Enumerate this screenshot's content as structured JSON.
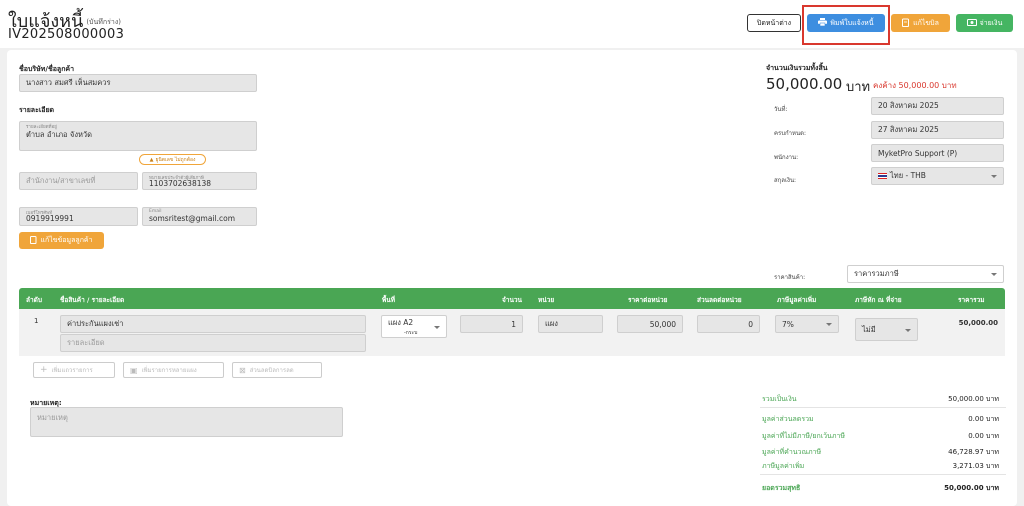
{
  "header": {
    "title": "ใบแจ้งหนี้",
    "title_note": "(บันทึกร่าง)",
    "doc_number": "IV202508000003"
  },
  "actions": {
    "close": "ปิดหน้าต่าง",
    "print": "พิมพ์ใบแจ้งหนี้",
    "edit": "แก้ไขบิล",
    "pay": "จ่ายเงิน"
  },
  "customer": {
    "section_label": "ชื่อบริษัท/ชื่อลูกค้า",
    "name": "นางสาว สมศรี เห็นสมควร",
    "detail_label": "รายละเอียด",
    "address_caption": "รายละเอียดที่อยู่",
    "address": "ตำบล อำเภอ จังหวัด",
    "branch_placeholder": "สำนักงาน/สาขาเลขที่",
    "verify_badge": "ยูนิตเลข ไม่ถูกต้อง",
    "tax_caption": "หมายเลขประจำตัวผู้เสียภาษี",
    "tax_id": "1103702638138",
    "phone_caption": "เบอร์โทรศัพท์",
    "phone": "0919919991",
    "email_caption": "Email",
    "email": "somsritest@gmail.com",
    "edit_button": "แก้ไขข้อมูลลูกค้า"
  },
  "summary_top": {
    "total_label": "จำนวนเงินรวมทั้งสิ้น",
    "total_amount": "50,000.00",
    "currency_unit": "บาท",
    "outstanding": "คงค้าง 50,000.00 บาท",
    "date_label": "วันที่:",
    "date": "20 สิงหาคม 2025",
    "due_label": "ครบกำหนด:",
    "due_date": "27 สิงหาคม 2025",
    "staff_label": "พนักงาน:",
    "staff": "MyketPro Support (P)",
    "currency_label": "สกุลเงิน:",
    "currency": "ไทย - THB",
    "price_type_label": "ราคาสินค้า:",
    "price_type": "ราคารวมภาษี"
  },
  "table": {
    "headers": {
      "no": "ลำดับ",
      "item": "ชื่อสินค้า / รายละเอียด",
      "area": "พื้นที่",
      "qty": "จำนวน",
      "unit": "หน่วย",
      "price": "ราคาต่อหน่วย",
      "discount": "ส่วนลดต่อหน่วย",
      "vat": "ภาษีมูลค่าเพิ่ม",
      "wht": "ภาษีหัก ณ ที่จ่าย",
      "total": "ราคารวม"
    },
    "rows": [
      {
        "no": "1",
        "item": "ค่าประกันแผงเช่า",
        "detail_placeholder": "รายละเอียด",
        "area": "แผง A2",
        "area_sub": "-กระบ",
        "qty": "1",
        "unit": "แผง",
        "price": "50,000",
        "discount": "0",
        "vat": "7%",
        "wht": "ไม่มี",
        "total": "50,000.00"
      }
    ]
  },
  "row_actions": {
    "add_row": "เพิ่มแถวรายการ",
    "add_many": "เพิ่มรายการหลายแผง",
    "bill_discount": "ส่วนลดบิลการลด"
  },
  "notes": {
    "label": "หมายเหตุ:",
    "placeholder": "หมายเหตุ"
  },
  "totals": [
    {
      "label": "รวมเป็นเงิน",
      "value": "50,000.00 บาท"
    },
    {
      "label": "มูลค่าส่วนลดรวม",
      "value": "0.00 บาท"
    },
    {
      "label": "มูลค่าที่ไม่มีภาษี/ยกเว้นภาษี",
      "value": "0.00 บาท"
    },
    {
      "label": "มูลค่าที่คำนวณภาษี",
      "value": "46,728.97 บาท"
    },
    {
      "label": "ภาษีมูลค่าเพิ่ม",
      "value": "3,271.03 บาท"
    },
    {
      "label": "ยอดรวมสุทธิ",
      "value": "50,000.00 บาท"
    }
  ],
  "colors": {
    "primary_blue": "#3d8ee0",
    "accent_orange": "#f0a53a",
    "success_green": "#45b562",
    "table_green": "#4aa654",
    "alert_red": "#d9382e"
  }
}
